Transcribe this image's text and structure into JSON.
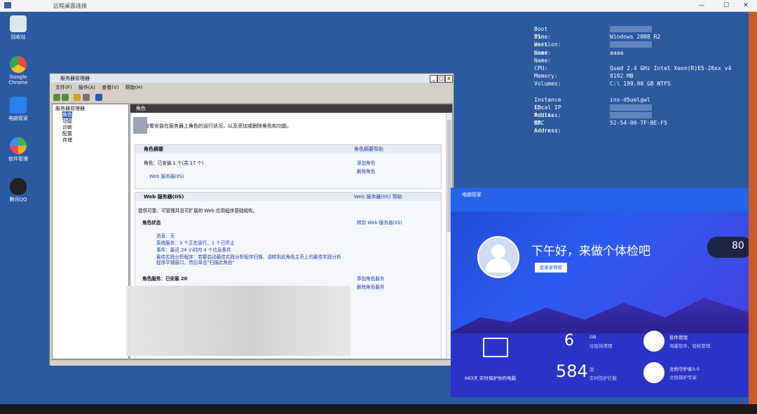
{
  "rdp": {
    "title": "远程桌面连接",
    "controls": [
      "—",
      "☐",
      "✕"
    ]
  },
  "desktop_icons": [
    {
      "label": "回收站",
      "color": "#dfe6ef"
    },
    {
      "label": "Google Chrome",
      "color": "#e24b3a"
    },
    {
      "label": "电脑管家",
      "color": "#2d7ff0"
    },
    {
      "label": "软件管理",
      "color": "#39b54a"
    },
    {
      "label": "腾讯QQ",
      "color": "#222222"
    }
  ],
  "sysinfo": [
    {
      "k": "Boot Time:",
      "v": ""
    },
    {
      "k": "OS Version:",
      "v": "Windows 2008 R2"
    },
    {
      "k": "Host Name:",
      "v": ""
    },
    {
      "k": "User Name:",
      "v": "aaaa"
    },
    {
      "k": "",
      "v": ""
    },
    {
      "k": "CPU:",
      "v": "Quad 2.4 GHz Intel Xeon(R)E5-26xx v4"
    },
    {
      "k": "Memory:",
      "v": "8192 MB"
    },
    {
      "k": "Volumes:",
      "v": "C:\\ 199.90 GB NTFS"
    },
    {
      "k": "",
      "v": ""
    },
    {
      "k": "Instance ID:",
      "v": "ins-d5uelgwl"
    },
    {
      "k": "Local IP Address:",
      "v": ""
    },
    {
      "k": "Public IP Address:",
      "v": ""
    },
    {
      "k": "MAC Address:",
      "v": "52-54-00-7F-BE-F5"
    }
  ],
  "server_manager": {
    "title": "服务器管理器",
    "menu": [
      "文件(F)",
      "操作(A)",
      "查看(V)",
      "帮助(H)"
    ],
    "tree": [
      "服务器管理器",
      "角色",
      "功能",
      "诊断",
      "配置",
      "存储"
    ],
    "content_title": "角色",
    "intro": "查看安装在服务器上角色的运行状况，以及添加或删除角色和功能。",
    "summary": {
      "title": "角色摘要",
      "help": "角色摘要帮助",
      "roles_line": "角色：已安装 1 个(共 17 个)",
      "role_item": "Web 服务器(IIS)",
      "add_role": "添加角色",
      "remove_role": "删除角色"
    },
    "iis": {
      "title": "Web 服务器(IIS)",
      "help": "Web 服务器(IIS) 帮助",
      "desc": "提供可靠、可管理并且可扩展的 Web 应用程序基础结构。",
      "status_title": "角色状态",
      "goto": "转到 Web 服务器(IIS)",
      "msg": "消息：无",
      "sys": "系统服务：3 个正在运行，1 个已停止",
      "events": "事件：最近 24 小时内 4 个信息事件",
      "bpa1": "最佳实践分析程序：若要启动最佳实践分析程序扫描，请转到此角色主页上的最佳实践分析",
      "bpa2": "程序平铺窗口，然后单击\"扫描此角色\"",
      "services": "角色服务：已安装 20",
      "add_service": "添加角色服务",
      "remove_service": "删除角色服务"
    }
  },
  "pc_manager": {
    "title": "电脑管家",
    "greeting": "下午好，来做个体检吧",
    "login": "登录享特权",
    "score": "80",
    "days_num": "683",
    "days_label": "683天 实时保护你的电脑",
    "gb_num": "6",
    "gb_unit": "GB",
    "gb_label": "垃圾待清理",
    "files_num": "584",
    "files_unit": "次",
    "files_label": "实时防护拦截",
    "soft_title": "软件管理",
    "soft_sub": "海量软件，轻松管理",
    "doc_title": "文档守护者3.0",
    "doc_sub": "文档保护专家"
  }
}
